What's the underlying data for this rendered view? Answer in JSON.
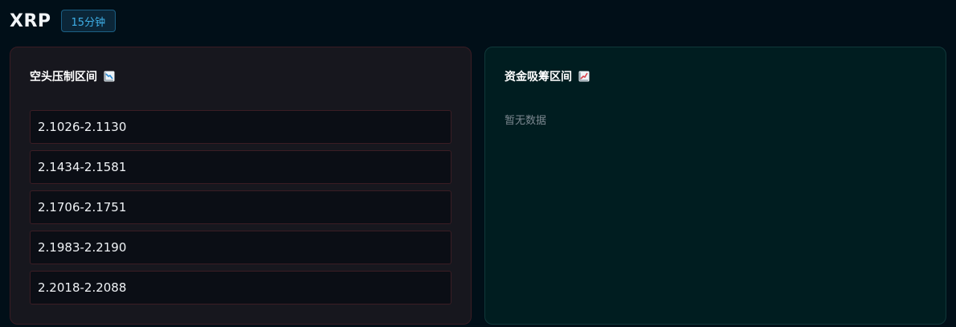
{
  "header": {
    "symbol": "XRP",
    "timeframe": "15分钟"
  },
  "bear_panel": {
    "title": "空头压制区间",
    "icon": "chart-decreasing-icon",
    "zones": [
      "2.1026-2.1130",
      "2.1434-2.1581",
      "2.1706-2.1751",
      "2.1983-2.2190",
      "2.2018-2.2088"
    ]
  },
  "bull_panel": {
    "title": "资金吸筹区间",
    "icon": "chart-increasing-icon",
    "empty_text": "暂无数据"
  },
  "colors": {
    "background": "#010f18",
    "bear_panel_bg": "#17171e",
    "bull_panel_bg": "#001d20",
    "badge_text": "#3fb0e8"
  }
}
